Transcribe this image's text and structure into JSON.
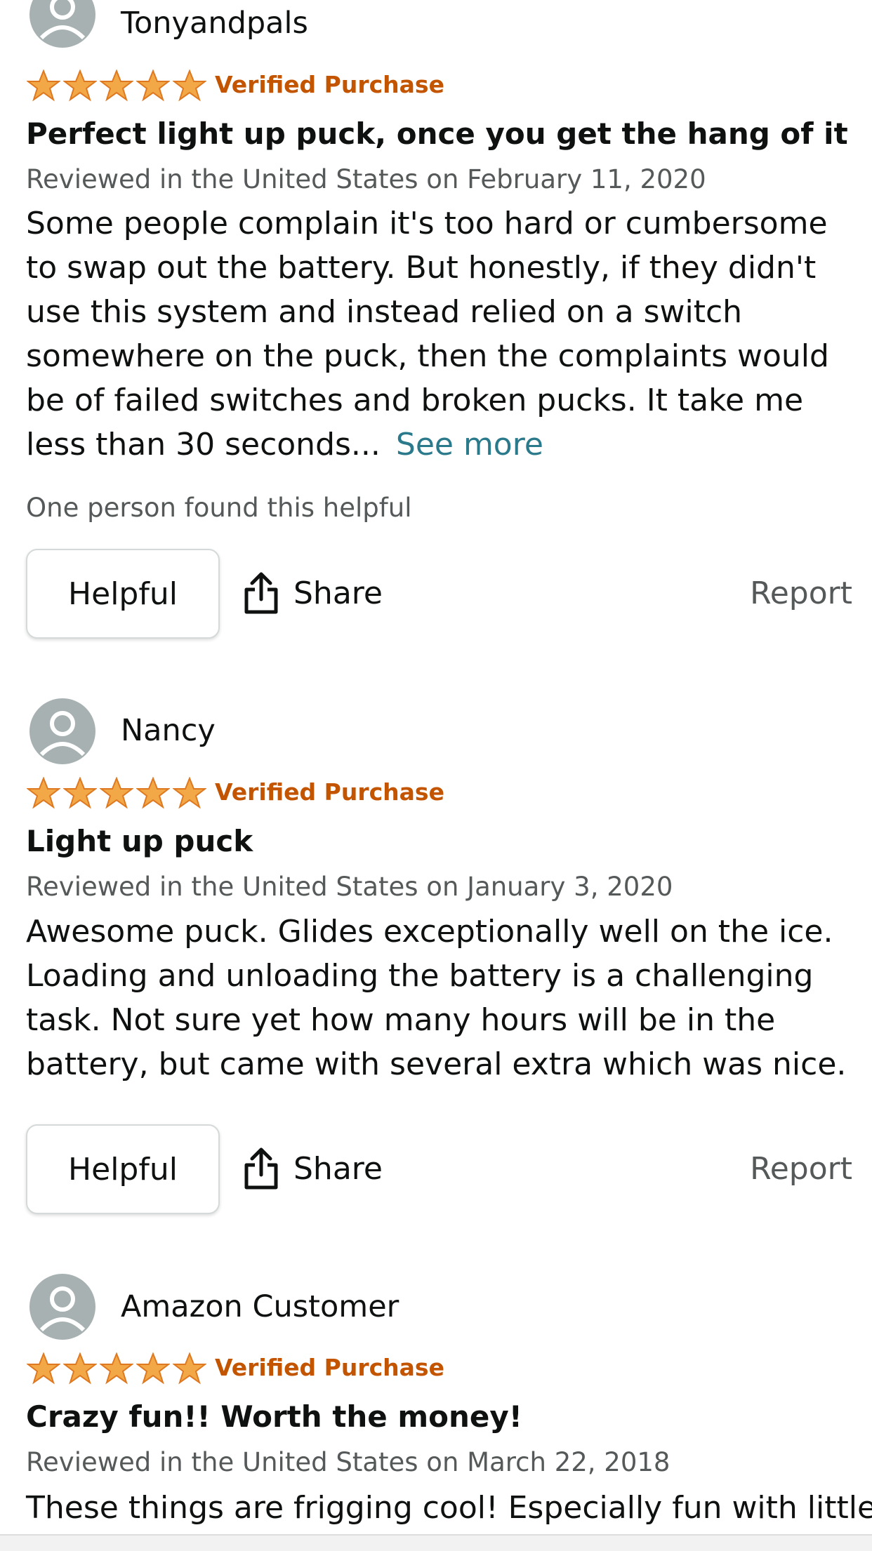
{
  "reviews": [
    {
      "author": "Tonyandpals",
      "rating": 5,
      "badge": "Verified Purchase",
      "title": "Perfect light up puck, once you get the hang of it",
      "date": "Reviewed in the United States on February 11, 2020",
      "body": "Some people complain it's too hard or cumbersome to swap out the battery. But honestly, if they didn't use this system and instead relied on a switch somewhere on the puck, then the complaints would be of failed switches and broken pucks. It take me less than 30 seconds...",
      "see_more": "See more",
      "helpful_count": "One person found this helpful",
      "helpful_label": "Helpful",
      "share_label": "Share",
      "report_label": "Report"
    },
    {
      "author": "Nancy",
      "rating": 5,
      "badge": "Verified Purchase",
      "title": "Light up puck",
      "date": "Reviewed in the United States on January 3, 2020",
      "body": "Awesome puck. Glides exceptionally well on the ice. Loading and unloading the battery is a challenging task. Not sure yet how many hours will be in the battery, but came with several extra which was nice.",
      "helpful_label": "Helpful",
      "share_label": "Share",
      "report_label": "Report"
    },
    {
      "author": "Amazon Customer",
      "rating": 5,
      "badge": "Verified Purchase",
      "title": "Crazy fun!! Worth the money!",
      "date": "Reviewed in the United States on March 22, 2018",
      "body": "These things are frigging cool! Especially fun with little"
    }
  ],
  "colors": {
    "star": "#f3a847",
    "star_outline": "#de7921",
    "verified": "#c45500",
    "link": "#2a7a8c",
    "muted": "#565959",
    "avatar_bg": "#a7b1b1"
  },
  "icons": {
    "avatar": "person-silhouette-icon",
    "star": "star-filled-icon",
    "share": "share-upload-icon"
  }
}
